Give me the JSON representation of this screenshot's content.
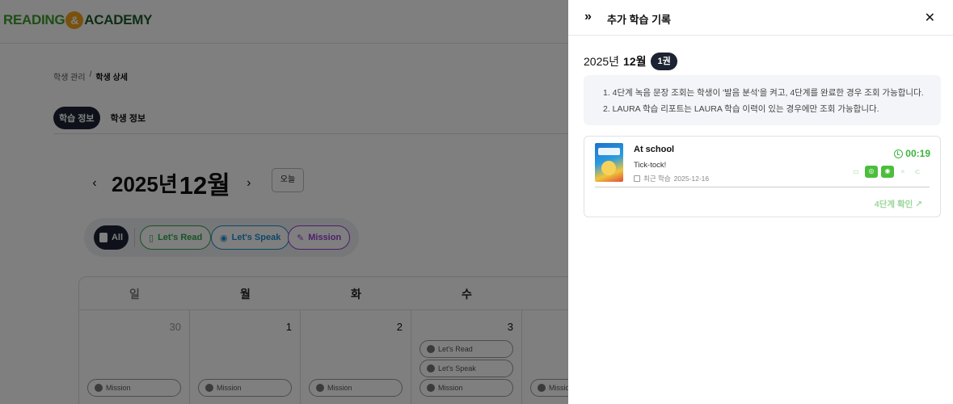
{
  "logo": {
    "part1": "READING",
    "amp": "&",
    "part2": "ACADEMY"
  },
  "breadcrumb": {
    "parent": "학생 관리",
    "sep": "/",
    "current": "학생 상세"
  },
  "tabs": [
    "학습 정보",
    "학생 정보"
  ],
  "month_nav": {
    "prev": "‹",
    "year": "2025년",
    "month": "12월",
    "next": "›",
    "today": "오늘"
  },
  "filters": {
    "all": "All",
    "read": "Let's Read",
    "speak": "Let's Speak",
    "mission": "Mission"
  },
  "calendar": {
    "weekdays": [
      "일",
      "월",
      "화",
      "수"
    ],
    "days": [
      "30",
      "1",
      "2",
      "3",
      ""
    ],
    "pills": {
      "mission": "Mission",
      "read": "Let's Read",
      "speak": "Let's Speak"
    }
  },
  "panel": {
    "expand_icon": "»",
    "title": "추가 학습 기록",
    "close_icon": "✕",
    "period_year": "2025년",
    "period_month": "12월",
    "count": "1권",
    "notices": [
      "1. 4단계 녹음 문장 조회는 학생이 '발음 분석'을 켜고, 4단계를 완료한 경우 조회 가능합니다.",
      "2. LAURA 학습 리포트는 LAURA 학습 이력이 있는 경우에만 조회 가능합니다."
    ],
    "book": {
      "title": "At school",
      "subtitle": "Tick-tock!",
      "recent_label": "최근 학습",
      "recent_date": "2025-12-16",
      "time": "00:19",
      "confirm_link": "4단계 확인 ↗"
    }
  },
  "colors": {
    "dark": "#1c2333",
    "green": "#3cb43c",
    "read": "#2ea84a",
    "speak": "#1f8fd1",
    "mission": "#9b3fd9"
  }
}
